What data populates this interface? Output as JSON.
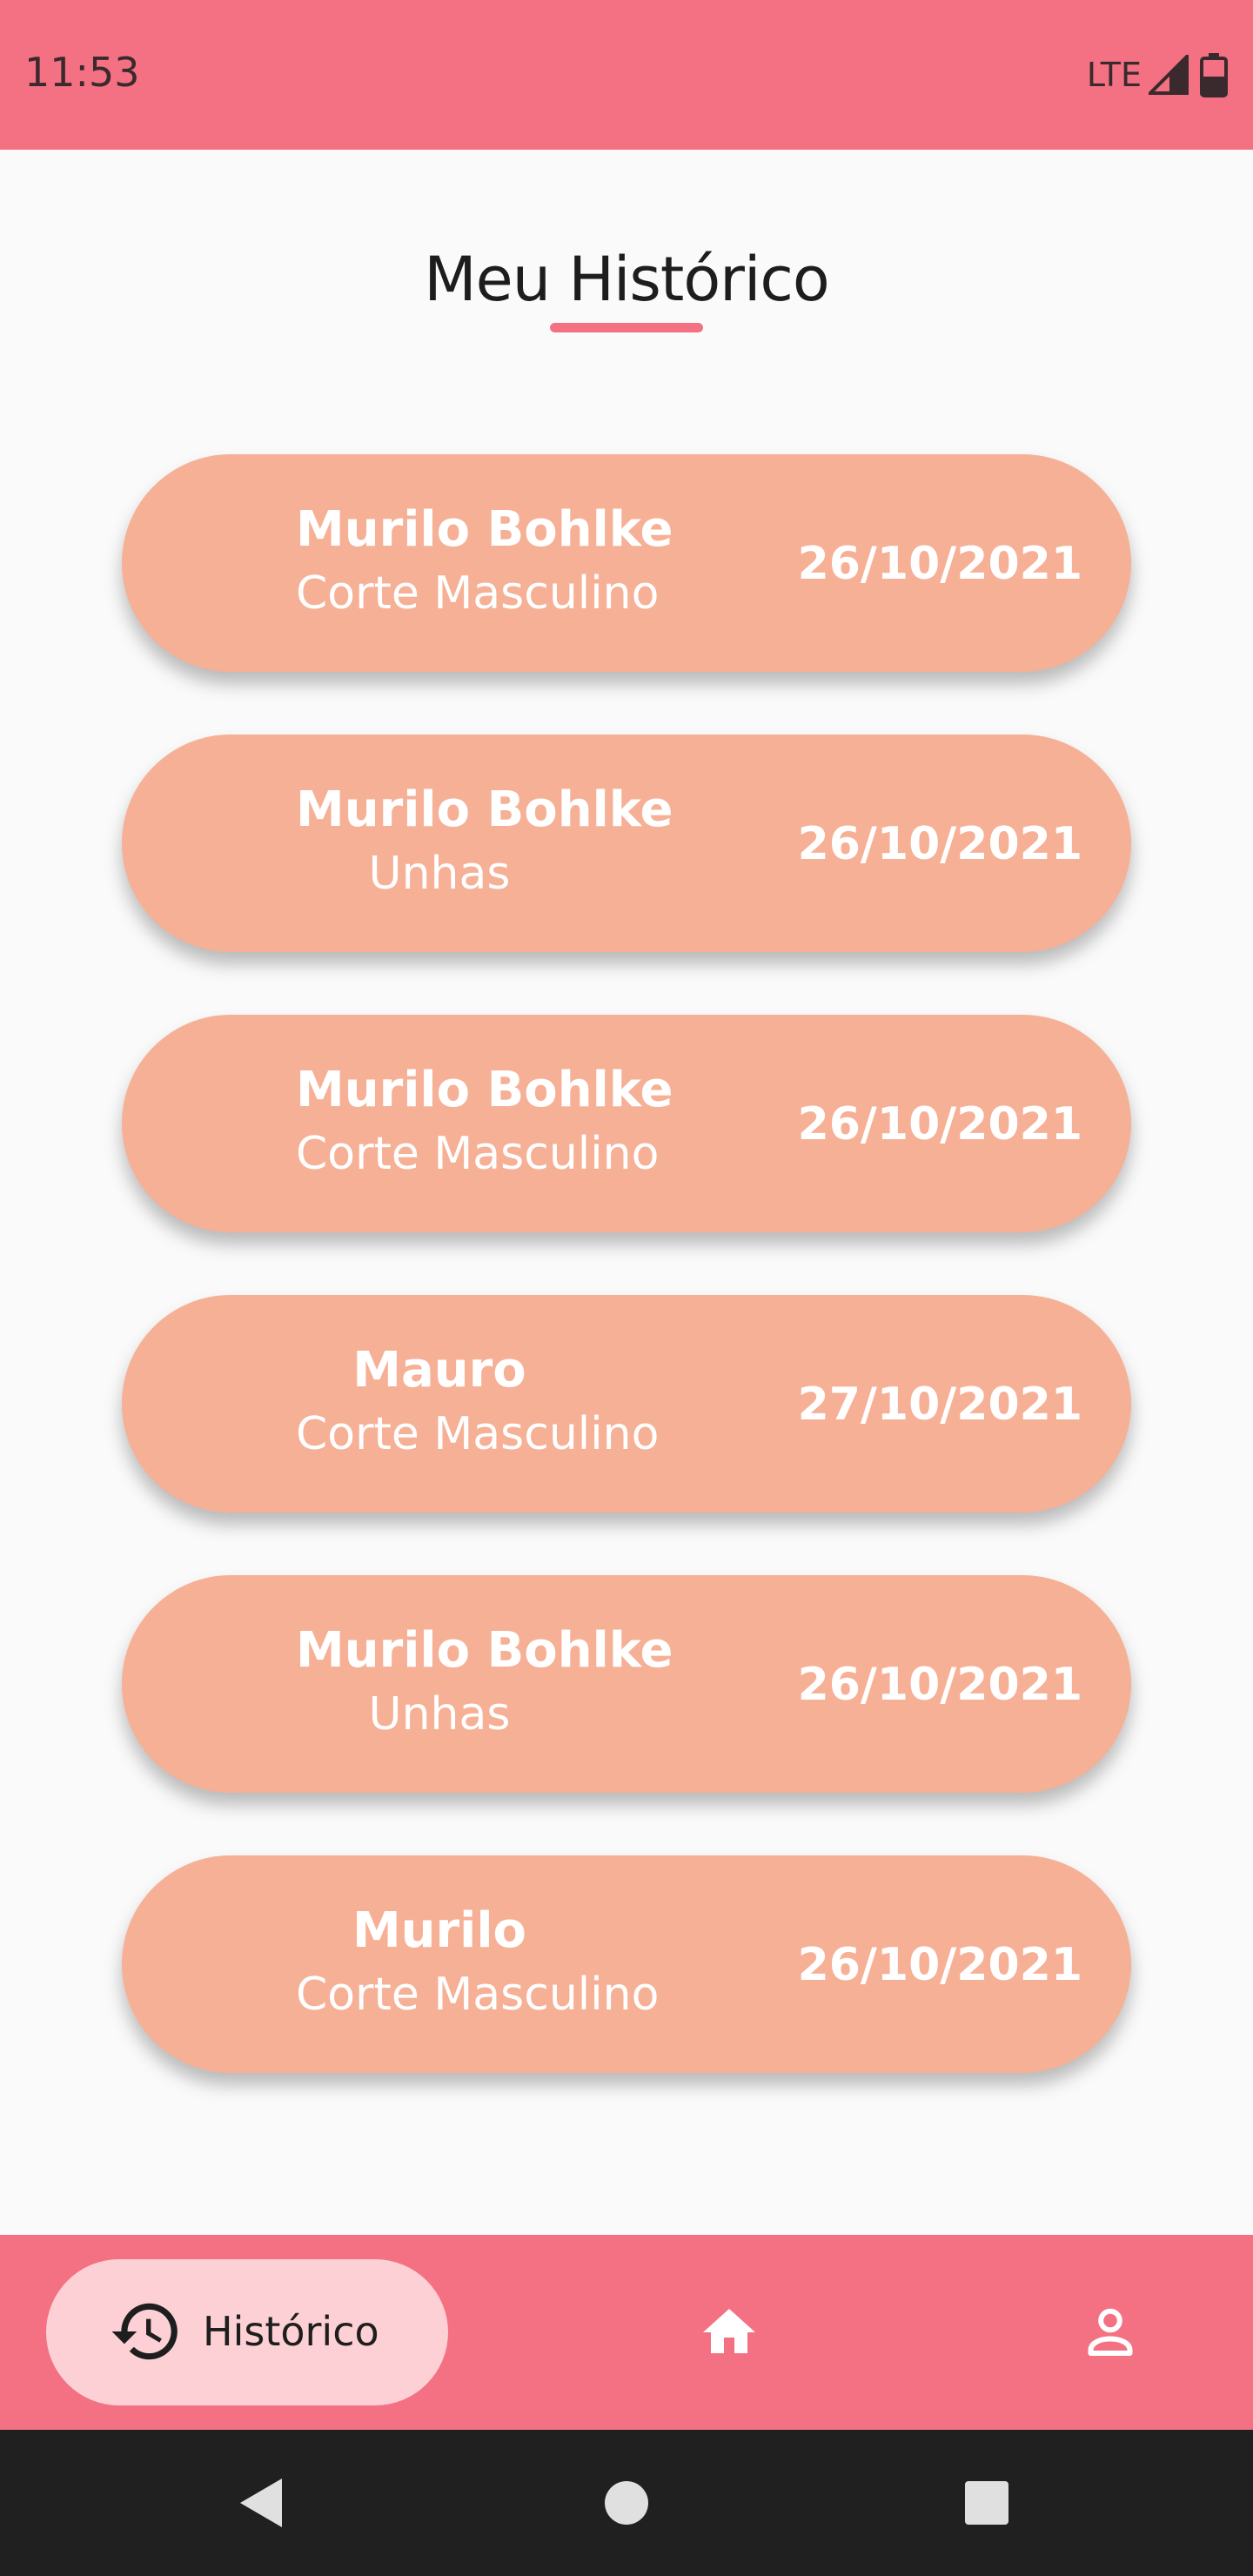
{
  "status_bar": {
    "time": "11:53",
    "network": "LTE",
    "icons": [
      "signal-icon",
      "battery-icon"
    ]
  },
  "page": {
    "title": "Meu Histórico"
  },
  "history": [
    {
      "name": "Murilo Bohlke",
      "service": "Corte Masculino",
      "date": "26/10/2021"
    },
    {
      "name": "Murilo Bohlke",
      "service": "Unhas",
      "date": "26/10/2021"
    },
    {
      "name": "Murilo Bohlke",
      "service": "Corte Masculino",
      "date": "26/10/2021"
    },
    {
      "name": "Mauro",
      "service": "Corte Masculino",
      "date": "27/10/2021"
    },
    {
      "name": "Murilo Bohlke",
      "service": "Unhas",
      "date": "26/10/2021"
    },
    {
      "name": "Murilo",
      "service": "Corte Masculino",
      "date": "26/10/2021"
    }
  ],
  "bottom_nav": {
    "items": [
      {
        "label": "Histórico",
        "icon": "history-icon",
        "active": true
      },
      {
        "icon": "home-icon"
      },
      {
        "icon": "profile-icon"
      }
    ]
  },
  "colors": {
    "primary": "#f37183",
    "card": "#f6b096",
    "active_pill": "#fdd0d5",
    "background": "#fafafa",
    "system_bar": "#202020"
  }
}
